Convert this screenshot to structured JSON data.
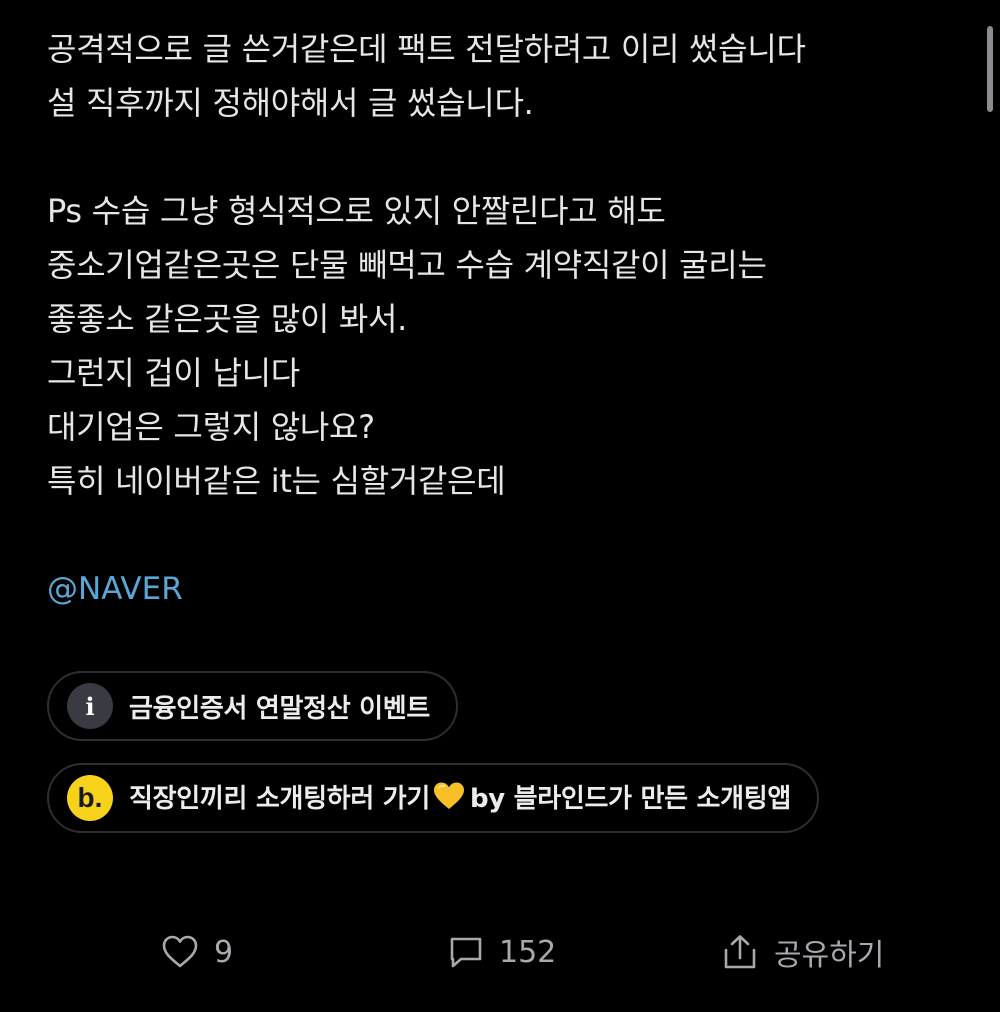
{
  "post": {
    "lines": [
      "공격적으로 글 쓴거같은데 팩트 전달하려고 이리 썼습니다",
      "설 직후까지 정해야해서 글 썼습니다.",
      "",
      "Ps 수습 그냥 형식적으로 있지 안짤린다고 해도",
      "중소기업같은곳은 단물 빼먹고 수습 계약직같이 굴리는",
      "좋좋소 같은곳을 많이 봐서.",
      "그런지 겁이 납니다",
      "대기업은 그렇지 않나요?",
      "특히 네이버같은 it는 심할거같은데"
    ],
    "mention": "@NAVER"
  },
  "chips": {
    "info": {
      "icon": "i",
      "label": "금융인증서 연말정산 이벤트"
    },
    "blind": {
      "icon": "b.",
      "label_before": "직장인끼리 소개팅하러 가기",
      "label_after": "by 블라인드가 만든 소개팅앱"
    }
  },
  "actions": {
    "likes": "9",
    "comments": "152",
    "share_label": "공유하기"
  },
  "colors": {
    "background": "#000000",
    "text": "#e6e6e8",
    "mention": "#5aa6d6",
    "muted": "#a8a8ae",
    "blind_yellow": "#f6d21b"
  },
  "icons": {
    "like": "heart-outline-icon",
    "comment": "speech-bubble-icon",
    "share": "share-upload-icon",
    "emoji": "yellow-heart-emoji"
  }
}
